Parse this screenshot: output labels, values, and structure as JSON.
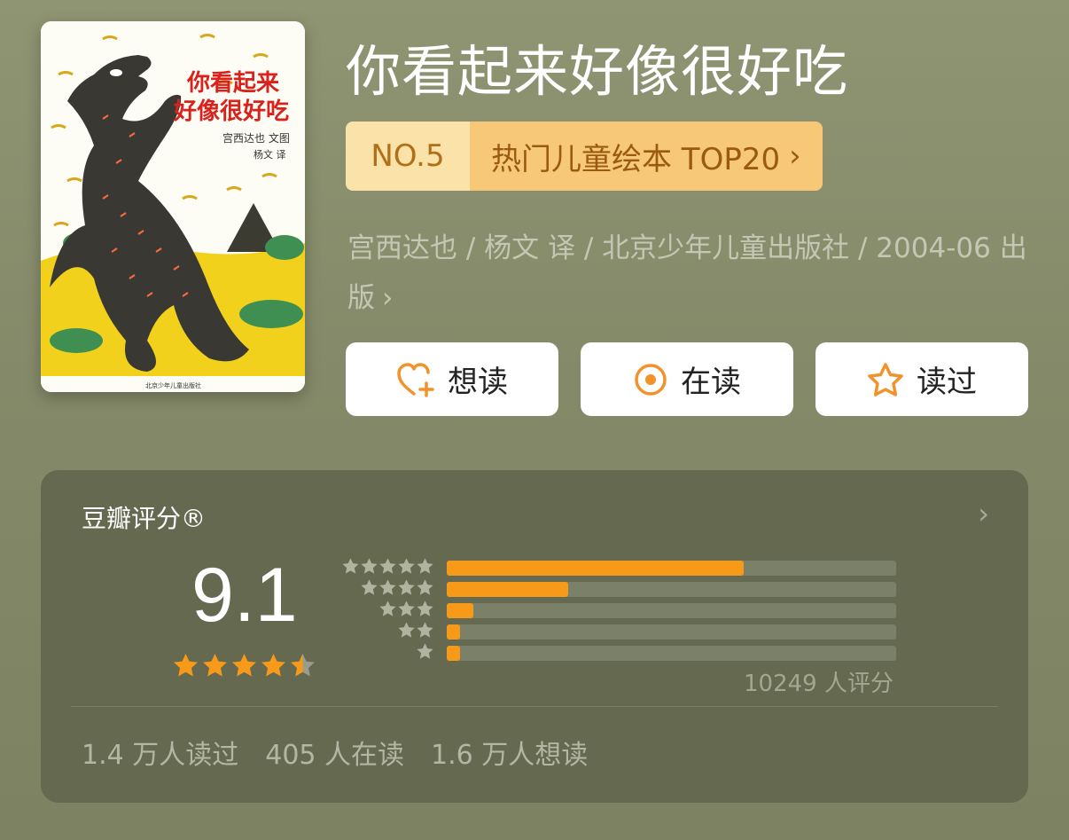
{
  "book": {
    "title": "你看起来好像很好吃",
    "cover": {
      "title_line1": "你看起来",
      "title_line2": "好像很好吃",
      "small_text": "宫西达也 文图",
      "translator": "杨文 译",
      "publisher_footer": "北京少年儿童出版社"
    }
  },
  "rank": {
    "number": "NO.5",
    "label": "热门儿童绘本 TOP20",
    "chevron": "›"
  },
  "meta": {
    "text": "宫西达也 / 杨文 译 / 北京少年儿童出版社 / 2004-06 出版",
    "chevron": "›"
  },
  "actions": [
    {
      "label": "想读",
      "icon": "heart-plus-icon"
    },
    {
      "label": "在读",
      "icon": "target-circle-icon"
    },
    {
      "label": "读过",
      "icon": "star-outline-icon"
    }
  ],
  "rating": {
    "title": "豆瓣评分®",
    "chevron": "›",
    "score": "9.1",
    "stars_filled": 4.5,
    "count_text": "10249 人评分",
    "distribution": [
      {
        "stars": 5,
        "fraction": 0.66
      },
      {
        "stars": 4,
        "fraction": 0.27
      },
      {
        "stars": 3,
        "fraction": 0.06
      },
      {
        "stars": 2,
        "fraction": 0.03
      },
      {
        "stars": 1,
        "fraction": 0.03
      }
    ],
    "stats": [
      "1.4 万人读过",
      "405 人在读",
      "1.6 万人想读"
    ]
  },
  "colors": {
    "accent": "#f79a1a",
    "background": "#878d6c",
    "card": "#646950",
    "rank_badge": "#fbe2a9",
    "rank_label": "#f7c877"
  }
}
